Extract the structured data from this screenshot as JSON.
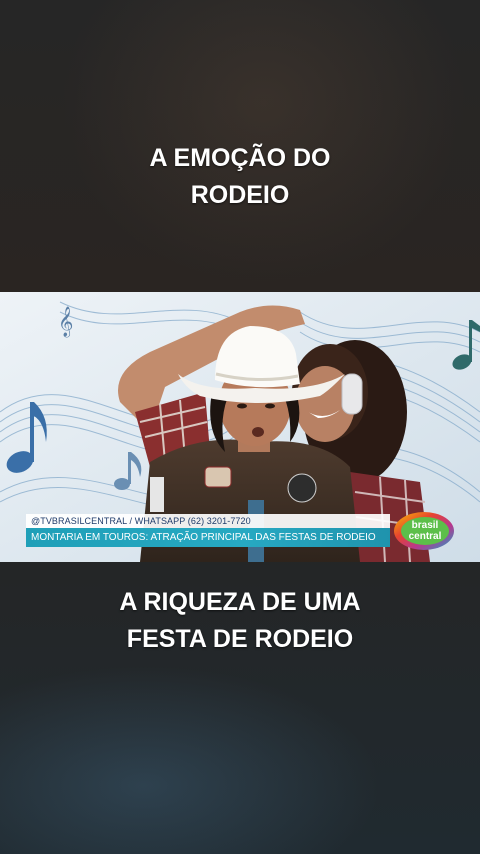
{
  "captions": {
    "top": [
      "A EMOÇÃO DO",
      "RODEIO"
    ],
    "bottom": [
      "A RIQUEZA DE UMA",
      "FESTA DE RODEIO"
    ]
  },
  "broadcast": {
    "handle_line": "@TVBRASILCENTRAL / WHATSAPP (62) 3201-7720",
    "headline": "MONTARIA EM TOUROS: ATRAÇÃO PRINCIPAL DAS FESTAS DE RODEIO",
    "logo_text": [
      "brasil",
      "central"
    ]
  },
  "colors": {
    "ticker_blue": "#27a9c2",
    "handle_text": "#1f3b6a",
    "caption_text": "#ffffff"
  }
}
